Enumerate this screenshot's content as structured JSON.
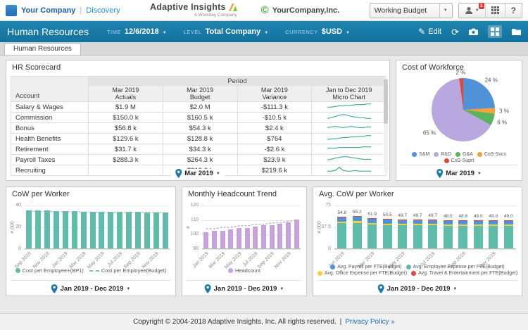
{
  "icons": {
    "caret_down": "▼",
    "pencil": "✎",
    "refresh": "⟳",
    "copyright_mark": "©"
  },
  "topbar": {
    "company": "Your Company",
    "separator": "|",
    "discovery": "Discovery",
    "logo_title": "Adaptive Insights",
    "logo_subtitle": "A Workday Company",
    "customer_name": "YourCompany,Inc.",
    "version_selector": "Working Budget",
    "notification_count": "1",
    "help_label": "?"
  },
  "header": {
    "title": "Human Resources",
    "filters": [
      {
        "label": "TIME",
        "value": "12/6/2018"
      },
      {
        "label": "LEVEL",
        "value": "Total Company"
      },
      {
        "label": "CURRENCY",
        "value": "$USD"
      }
    ],
    "edit_label": "Edit"
  },
  "tab": {
    "label": "Human Resources"
  },
  "scorecard": {
    "title": "HR Scorecard",
    "account_header": "Account",
    "period_header": "Period",
    "columns": [
      [
        "Mar 2019",
        "Actuals"
      ],
      [
        "Mar 2019",
        "Budget"
      ],
      [
        "Mar 2019",
        "Variance"
      ],
      [
        "Jan to Dec 2019",
        "Micro Chart"
      ]
    ],
    "rows": [
      {
        "account": "Salary & Wages",
        "actuals": "$1.9 M",
        "budget": "$2.0 M",
        "variance": "-$111.3 k",
        "spark": [
          3,
          3,
          4,
          5,
          5,
          6,
          6,
          7,
          7,
          7,
          8,
          8
        ]
      },
      {
        "account": "Commission",
        "actuals": "$150.0 k",
        "budget": "$160.5 k",
        "variance": "-$10.5 k",
        "spark": [
          2,
          3,
          5,
          7,
          8,
          7,
          5,
          4,
          3,
          3,
          2,
          2
        ]
      },
      {
        "account": "Bonus",
        "actuals": "$56.8 k",
        "budget": "$54.3 k",
        "variance": "$2.4 k",
        "spark": [
          4,
          5,
          6,
          5,
          4,
          5,
          6,
          5,
          4,
          4,
          5,
          5
        ]
      },
      {
        "account": "Health Benefits",
        "actuals": "$129.6 k",
        "budget": "$128.8 k",
        "variance": "$764",
        "spark": [
          2,
          3,
          3,
          4,
          5,
          5,
          6,
          6,
          7,
          7,
          8,
          8
        ]
      },
      {
        "account": "Retirement",
        "actuals": "$31.7 k",
        "budget": "$34.3 k",
        "variance": "-$2.6 k",
        "spark": [
          5,
          5,
          5,
          6,
          6,
          6,
          6,
          6,
          6,
          7,
          7,
          7
        ]
      },
      {
        "account": "Payroll Taxes",
        "actuals": "$288.3 k",
        "budget": "$264.3 k",
        "variance": "$23.9 k",
        "spark": [
          3,
          4,
          6,
          7,
          8,
          8,
          7,
          6,
          5,
          4,
          4,
          4
        ]
      },
      {
        "account": "Recruiting",
        "actuals": "",
        "budget": "$219.6 k",
        "variance": "$219.6 k",
        "spark": [
          2,
          2,
          3,
          8,
          3,
          2,
          2,
          3,
          2,
          2,
          2,
          2
        ]
      }
    ],
    "period_selector": "Mar 2019"
  },
  "chart_data": [
    {
      "id": "cost-of-workforce",
      "type": "pie",
      "title": "Cost of Workforce",
      "slices": [
        {
          "label": "S&M",
          "value": 24,
          "color": "#4f92d8"
        },
        {
          "label": "CoS-Svcs",
          "value": 3,
          "color": "#f2a13c"
        },
        {
          "label": "G&A",
          "value": 6,
          "color": "#58b55c"
        },
        {
          "label": "R&D",
          "value": 65,
          "color": "#b9a7e0"
        },
        {
          "label": "CoS-Suprt",
          "value": 2,
          "color": "#e0483b"
        }
      ],
      "legend_order": [
        "S&M",
        "R&D",
        "G&A",
        "CoS-Svcs",
        "CoS-Suprt"
      ],
      "slice_label_suffix": " %",
      "period_selector": "Mar 2019"
    },
    {
      "id": "cow-per-worker",
      "type": "bar",
      "title": "CoW per Worker",
      "ylabel": "#,000",
      "ylim": [
        0,
        40
      ],
      "yticks": [
        0,
        20,
        40
      ],
      "categories": [
        "Sep 2018",
        "Oct 2018",
        "Nov 2018",
        "Dec 2018",
        "Jan 2019",
        "Feb 2019",
        "Mar 2019",
        "Apr 2019",
        "May 2019",
        "Jun 2019",
        "Jul 2019",
        "Aug 2019",
        "Sep 2019",
        "Oct 2019",
        "Nov 2019",
        "Dec 2019"
      ],
      "x_label_every": 2,
      "series": [
        {
          "name": "Cost per Employee+(BP1)",
          "style": "bar",
          "color": "#5fbcaa",
          "values": [
            35.0,
            34.8,
            34.6,
            34.4,
            34.2,
            34.0,
            33.9,
            33.8,
            33.7,
            33.6,
            33.5,
            33.4,
            33.3,
            33.2,
            33.1,
            33.0
          ]
        },
        {
          "name": "Cost per Employee(Budget)",
          "style": "dashed-line",
          "color": "#97b8b0",
          "values": [
            34.6,
            34.5,
            34.4,
            34.3,
            34.2,
            34.1,
            34.0,
            34.0,
            33.9,
            33.8,
            33.8,
            33.7,
            33.7,
            33.6,
            33.6,
            33.5
          ]
        }
      ],
      "period_selector": "Jan 2019 - Dec 2019"
    },
    {
      "id": "monthly-headcount-trend",
      "type": "bar",
      "title": "Monthly Headcount Trend",
      "ylabel": "#",
      "ylim": [
        90,
        120
      ],
      "yticks": [
        90,
        100,
        110,
        120
      ],
      "categories": [
        "Jan 2019",
        "Feb 2019",
        "Mar 2019",
        "Apr 2019",
        "May 2019",
        "Jun 2019",
        "Jul 2019",
        "Aug 2019",
        "Sep 2019",
        "Oct 2019",
        "Nov 2019",
        "Dec 2019"
      ],
      "x_label_every": 2,
      "series": [
        {
          "name": "Headcount",
          "style": "bar",
          "color": "#c8a2dc",
          "values": [
            101,
            102,
            102,
            103,
            104,
            104,
            105,
            106,
            106,
            107,
            108,
            110
          ]
        },
        {
          "name": "",
          "style": "dashed-line",
          "color": "#b3a6bf",
          "values": [
            104,
            104,
            105,
            105,
            106,
            106,
            107,
            107,
            108,
            108,
            109,
            110
          ]
        }
      ],
      "period_selector": "Jan 2019 - Dec 2019"
    },
    {
      "id": "avg-cow-per-worker",
      "type": "bar",
      "stacked": true,
      "title": "Avg. CoW per Worker",
      "ylabel": "#,000",
      "ylim": [
        0,
        75
      ],
      "yticks": [
        0,
        37.5,
        75
      ],
      "categories": [
        "Jan 2019",
        "Feb 2019",
        "Mar 2019",
        "Apr 2019",
        "May 2019",
        "Jun 2019",
        "Jul 2019",
        "Aug 2019",
        "Sep 2019",
        "Oct 2019",
        "Nov 2019",
        "Dec 2019"
      ],
      "x_label_every": 2,
      "totals": [
        54.8,
        55.2,
        51.9,
        50.5,
        49.7,
        49.7,
        49.7,
        48.5,
        48.8,
        49.0,
        49.0,
        49.0
      ],
      "bar_value_labels": [
        "54.8",
        "55.2",
        "51.9",
        "50.5",
        "49.7",
        "49.7",
        "49.7",
        "48.5",
        "48.8",
        "49.0",
        "49.0",
        "49.0"
      ],
      "stack": [
        {
          "name": "Avg. Employee Expense per FTE(Budget)",
          "color": "#5fbcaa",
          "fraction": 0.8
        },
        {
          "name": "Avg. Office Expense per FTE(Budget)",
          "color": "#f3d13e",
          "fraction": 0.05
        },
        {
          "name": "Avg. Payroll per FTE(Budget)",
          "color": "#4f92d8",
          "fraction": 0.13
        },
        {
          "name": "Avg. Travel & Entertainment per FTE(Budget)",
          "color": "#e0483b",
          "fraction": 0.02
        }
      ],
      "legend_order": [
        "Avg. Payroll per FTE(Budget)",
        "Avg. Employee Expense per FTE(Budget)",
        "Avg. Office Expense per FTE(Budget)",
        "Avg. Travel & Entertainment per FTE(Budget)"
      ],
      "period_selector": "Jan 2019 - Dec 2019"
    }
  ],
  "footer": {
    "copyright": "Copyright © 2004-2018 Adaptive Insights, Inc. All rights reserved.",
    "separator": "|",
    "privacy": "Privacy Policy »"
  }
}
